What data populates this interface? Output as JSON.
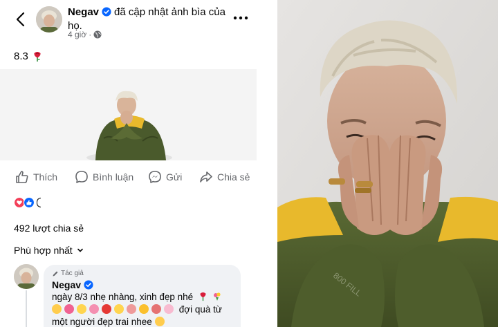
{
  "post": {
    "author": "Negav",
    "action_text": "đã cập nhật ảnh bìa của họ.",
    "time": "4 giờ",
    "audience_icon": "globe-icon",
    "body": "8.3",
    "body_emoji": "rose-emoji"
  },
  "actions": {
    "like": "Thích",
    "comment": "Bình luận",
    "send": "Gửi",
    "share": "Chia sẻ"
  },
  "stats": {
    "shares": "492 lượt chia sẻ"
  },
  "comments_section": {
    "sort_label": "Phù hợp nhất"
  },
  "comment": {
    "badge": "Tác giả",
    "author": "Negav",
    "line1": "ngày 8/3 nhẹ nhàng, xinh đẹp nhé",
    "line2": "đợi quà từ",
    "line3": "một người đẹp trai nhee"
  },
  "colors": {
    "facebook_blue": "#0866ff",
    "love_red": "#f33e58",
    "secondary_text": "#65676b",
    "bubble_bg": "#f0f2f5",
    "jacket_green": "#4a5a2c",
    "jacket_yellow": "#e8b92c"
  }
}
